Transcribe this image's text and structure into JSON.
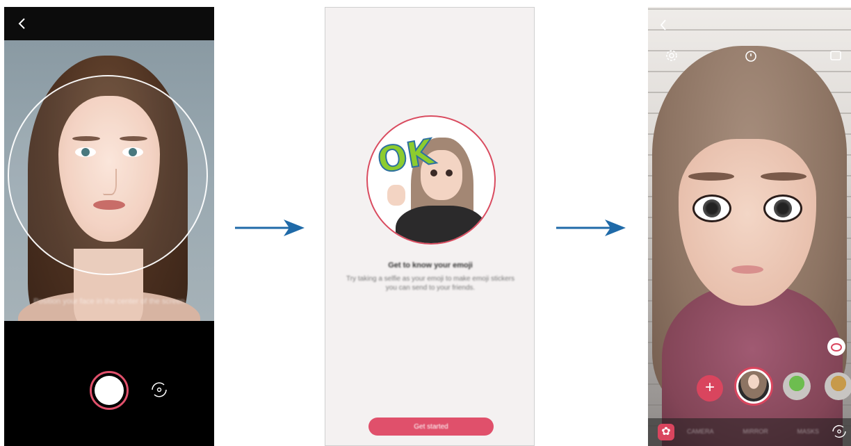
{
  "screen1": {
    "instruction": "Position your face in the center of the screen"
  },
  "screen2": {
    "sticker_text": "OK",
    "title": "Get to know your emoji",
    "description": "Try taking a selfie as your emoji to make emoji stickers you can send to your friends.",
    "start_button": "Get started"
  },
  "screen3": {
    "add_symbol": "+",
    "mode_tabs": [
      "CAMERA",
      "MIRROR",
      "MASKS"
    ],
    "flower_symbol": "✿"
  },
  "colors": {
    "accent": "#e0506b",
    "arrow": "#1f6aa8"
  }
}
